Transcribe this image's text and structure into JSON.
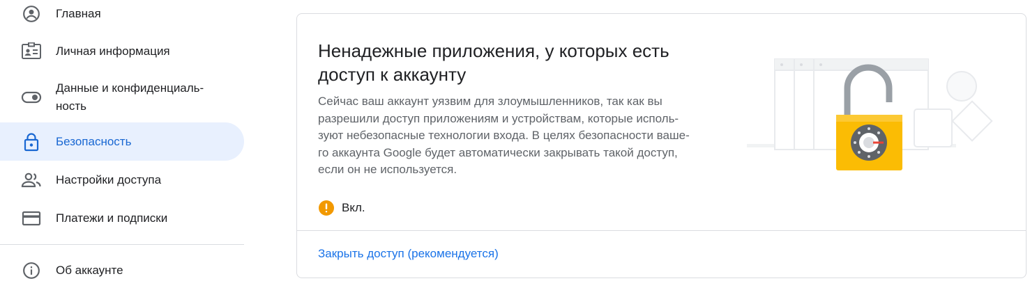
{
  "sidebar": {
    "items": [
      {
        "label": "Главная",
        "icon": "account-circle-icon"
      },
      {
        "label": "Личная информация",
        "icon": "id-card-icon"
      },
      {
        "label": "Данные и конфиденциаль-\nность",
        "icon": "toggle-icon"
      },
      {
        "label": "Безопасность",
        "icon": "lock-icon",
        "active": true
      },
      {
        "label": "Настройки доступа",
        "icon": "people-icon"
      },
      {
        "label": "Платежи и подписки",
        "icon": "credit-card-icon"
      },
      {
        "label": "Об аккаунте",
        "icon": "info-icon"
      }
    ]
  },
  "card": {
    "title": "Ненадежные приложения, у которых есть\nдоступ к аккаунту",
    "description": "Сейчас ваш аккаунт уязвим для злоумышленников, так как вы\nразрешили доступ приложениям и устройствам, которые исполь-\nзуют небезопасные технологии входа. В целях безопасности ваше-\nго аккаунта Google будет автоматически закрывать такой доступ,\nесли он не используется.",
    "status": {
      "text": "Вкл.",
      "icon": "warning-icon",
      "color": "#f29900"
    },
    "action_link": "Закрыть доступ (рекомендуется)"
  },
  "colors": {
    "accent": "#1a73e8",
    "active_bg": "#e8f0fe",
    "active_text": "#1967d2",
    "warning": "#f29900",
    "lock_body": "#fbbc04"
  }
}
